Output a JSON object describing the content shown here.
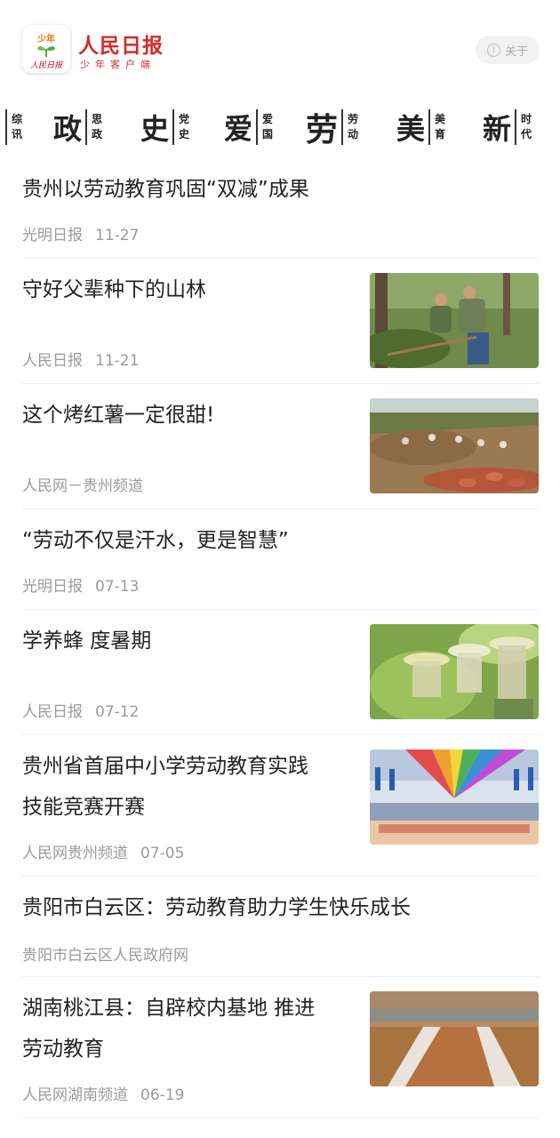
{
  "header": {
    "logo_top": "少年",
    "logo_bottom": "人民日报",
    "brand_title": "人民日报",
    "brand_subtitle": "少年客户端",
    "about_label": "关于",
    "colors": {
      "brand": "#d42b2b",
      "logo_green": "#5aa63a",
      "logo_orange": "#e8731f"
    }
  },
  "categories": [
    {
      "big": "",
      "small": [
        "综",
        "讯"
      ]
    },
    {
      "big": "政",
      "small": [
        "思",
        "政"
      ]
    },
    {
      "big": "史",
      "small": [
        "党",
        "史"
      ]
    },
    {
      "big": "爱",
      "small": [
        "爱",
        "国"
      ]
    },
    {
      "big": "劳",
      "small": [
        "劳",
        "动"
      ]
    },
    {
      "big": "美",
      "small": [
        "美",
        "育"
      ]
    },
    {
      "big": "新",
      "small": [
        "时",
        "代"
      ]
    }
  ],
  "news": [
    {
      "title_lines": [
        "贵州以劳动教育巩固“双减”成果"
      ],
      "source": "光明日报",
      "date": "11-27",
      "thumb": ""
    },
    {
      "title_lines": [
        "守好父辈种下的山林"
      ],
      "source": "人民日报",
      "date": "11-21",
      "thumb": "forest"
    },
    {
      "title_lines": [
        "这个烤红薯一定很甜!"
      ],
      "source": "人民网－贵州频道",
      "date": "",
      "thumb": "sweetpotato"
    },
    {
      "title_lines": [
        "“劳动不仅是汗水，更是智慧”"
      ],
      "source": "光明日报",
      "date": "07-13",
      "thumb": ""
    },
    {
      "title_lines": [
        "学养蜂 度暑期"
      ],
      "source": "人民日报",
      "date": "07-12",
      "thumb": "bees"
    },
    {
      "title_lines": [
        "贵州省首届中小学劳动教育实践",
        "技能竞赛开赛"
      ],
      "source": "人民网贵州频道",
      "date": "07-05",
      "thumb": "gym"
    },
    {
      "title_lines": [
        "贵阳市白云区：劳动教育助力学生快乐成长"
      ],
      "source": "贵阳市白云区人民政府网",
      "date": "",
      "thumb": ""
    },
    {
      "title_lines": [
        "湖南桃江县：自辟校内基地 推进",
        "劳动教育"
      ],
      "source": "人民网湖南频道",
      "date": "06-19",
      "thumb": "field"
    }
  ]
}
